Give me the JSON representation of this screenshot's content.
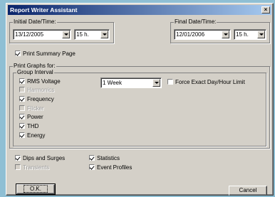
{
  "window": {
    "title": "Report Writer Assistant",
    "close_glyph": "×"
  },
  "initial": {
    "legend": "Initial Date/Time:",
    "date": "13/12/2005",
    "hour": "15 h."
  },
  "final": {
    "legend": "Final Date/Time:",
    "date": "12/01/2006",
    "hour": "15 h."
  },
  "print_summary": {
    "label": "Print Summary Page",
    "checked": true
  },
  "graphs": {
    "legend": "Print Graphs for:",
    "group_legend": "Group Interval",
    "interval": "1 Week",
    "force_exact": {
      "label": "Force Exact Day/Hour Limit",
      "checked": false
    },
    "items": [
      {
        "label": "RMS Voltage",
        "checked": true,
        "enabled": true
      },
      {
        "label": "Harmonics",
        "checked": false,
        "enabled": false
      },
      {
        "label": "Frequency",
        "checked": true,
        "enabled": true
      },
      {
        "label": "Flicker",
        "checked": false,
        "enabled": false
      },
      {
        "label": "Power",
        "checked": true,
        "enabled": true
      },
      {
        "label": "THD",
        "checked": true,
        "enabled": true
      },
      {
        "label": "Energy",
        "checked": true,
        "enabled": true
      }
    ]
  },
  "bottom": {
    "dips": {
      "label": "Dips and Surges",
      "checked": true,
      "enabled": true
    },
    "transients": {
      "label": "Transients",
      "checked": false,
      "enabled": false
    },
    "statistics": {
      "label": "Statistics",
      "checked": true,
      "enabled": true
    },
    "events": {
      "label": "Event Profiles",
      "checked": true,
      "enabled": true
    }
  },
  "buttons": {
    "ok": "O.K.",
    "cancel": "Cancel"
  }
}
